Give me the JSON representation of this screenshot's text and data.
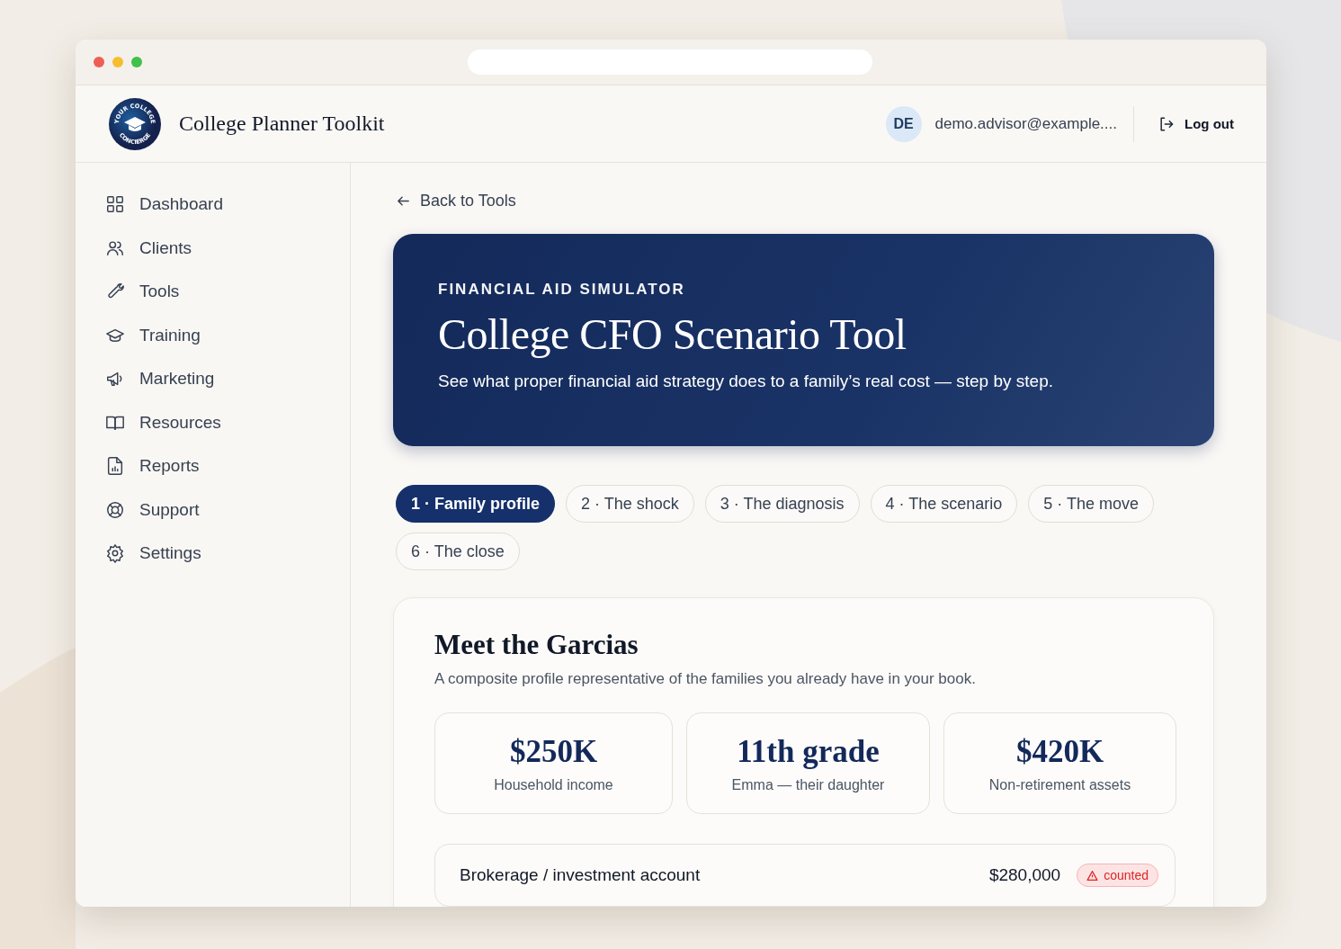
{
  "logo": {
    "top_text": "YOUR COLLEGE",
    "bottom_text": "CONCIERGE"
  },
  "app_title": "College Planner Toolkit",
  "user": {
    "initials": "DE",
    "email": "demo.advisor@example....",
    "logout": "Log out"
  },
  "sidebar": {
    "items": [
      {
        "label": "Dashboard"
      },
      {
        "label": "Clients"
      },
      {
        "label": "Tools"
      },
      {
        "label": "Training"
      },
      {
        "label": "Marketing"
      },
      {
        "label": "Resources"
      },
      {
        "label": "Reports"
      },
      {
        "label": "Support"
      },
      {
        "label": "Settings"
      }
    ]
  },
  "back_link": "Back to Tools",
  "hero": {
    "eyebrow": "FINANCIAL AID SIMULATOR",
    "title": "College CFO Scenario Tool",
    "subtitle": "See what proper financial aid strategy does to a family’s real cost — step by step."
  },
  "steps": [
    {
      "label": "1 · Family profile",
      "selected": true
    },
    {
      "label": "2 · The shock",
      "selected": false
    },
    {
      "label": "3 · The diagnosis",
      "selected": false
    },
    {
      "label": "4 · The scenario",
      "selected": false
    },
    {
      "label": "5 · The move",
      "selected": false
    },
    {
      "label": "6 · The close",
      "selected": false
    }
  ],
  "profile": {
    "title": "Meet the Garcias",
    "description": "A composite profile representative of the families you already have in your book.",
    "stats": [
      {
        "value": "$250K",
        "label": "Household income"
      },
      {
        "value": "11th grade",
        "label": "Emma — their daughter"
      },
      {
        "value": "$420K",
        "label": "Non-retirement assets"
      }
    ],
    "assets": [
      {
        "name": "Brokerage / investment account",
        "amount": "$280,000",
        "status": "counted",
        "flagged": true
      }
    ]
  }
}
